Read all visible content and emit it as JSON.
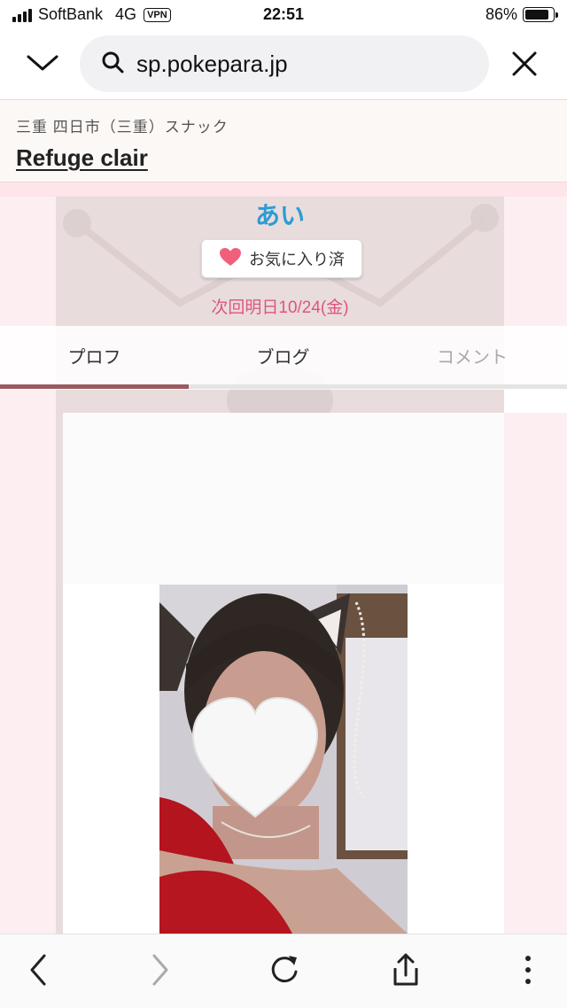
{
  "status_bar": {
    "carrier": "SoftBank",
    "network": "4G",
    "vpn": "VPN",
    "time": "22:51",
    "battery": "86%",
    "battery_level": 0.86
  },
  "browser": {
    "url": "sp.pokepara.jp",
    "icons": {
      "collapse": "chevron-down-icon",
      "search": "search-icon",
      "close": "close-icon"
    }
  },
  "site": {
    "breadcrumb": "三重 四日市（三重）スナック",
    "shop_name": "Refuge clair"
  },
  "profile": {
    "name": "あい",
    "favorite_label": "お気に入り済",
    "next_shift": "次回明日10/24(金)"
  },
  "tabs": [
    {
      "label": "プロフ",
      "active": true
    },
    {
      "label": "ブログ",
      "active": false
    },
    {
      "label": "コメント",
      "active": false
    }
  ],
  "photo": {
    "icon": "heart-sticker-icon"
  },
  "toolbar": {
    "icons": [
      "back-icon",
      "forward-icon",
      "reload-icon",
      "share-icon",
      "more-icon"
    ]
  },
  "colors": {
    "name": "#2d9bd4",
    "next_shift": "#e0567a",
    "heart": "#f0607a",
    "tab_indicator": "#9a5a5e"
  }
}
